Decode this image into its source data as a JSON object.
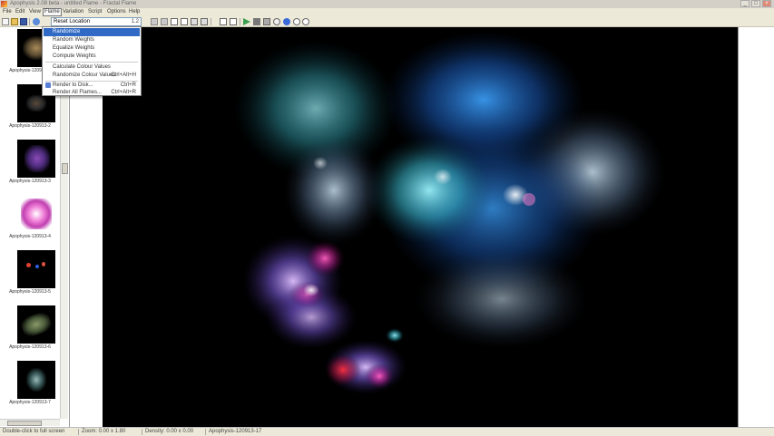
{
  "window": {
    "title": "Apophysis 2.08 beta - untitled Flame - Fractal Flame",
    "minimize": "_",
    "maximize": "□",
    "close": "×"
  },
  "menubar": {
    "items": [
      "File",
      "Edit",
      "View",
      "Flame",
      "Variation",
      "Script",
      "Options",
      "Help"
    ],
    "active": "Flame"
  },
  "toolbar": {
    "preset_value": "Reset Location",
    "preset_number": "1.2"
  },
  "flame_menu": {
    "items": [
      {
        "label": "Randomize",
        "shortcut": "",
        "highlight": true
      },
      {
        "label": "Random Weights",
        "shortcut": ""
      },
      {
        "label": "Equalize Weights",
        "shortcut": ""
      },
      {
        "label": "Compute Weights",
        "shortcut": ""
      },
      {
        "label": "Calculate Colour Values",
        "shortcut": ""
      },
      {
        "label": "Randomize Colour Values",
        "shortcut": "Ctrl+Alt+H"
      },
      {
        "label": "Render to Disk...",
        "shortcut": "Ctrl+R"
      },
      {
        "label": "Render All Flames...",
        "shortcut": "Ctrl+Alt+R"
      }
    ]
  },
  "sidebar": {
    "thumbnails": [
      {
        "label": "Apophysis-120913-1"
      },
      {
        "label": "Apophysis-120913-2"
      },
      {
        "label": "Apophysis-120913-3"
      },
      {
        "label": "Apophysis-120913-4"
      },
      {
        "label": "Apophysis-120913-5"
      },
      {
        "label": "Apophysis-120913-6"
      },
      {
        "label": "Apophysis-120913-7"
      }
    ]
  },
  "status": {
    "left": "Double-click to full screen",
    "zoom": "Zoom: 0.00 x 1.80",
    "density": "Density: 0.00 x 0.00",
    "name": "Apophysis-120913-17"
  },
  "colors": {
    "canvas_bg": "#000000",
    "menu_highlight": "#316ac5",
    "chrome": "#ece9d8"
  }
}
